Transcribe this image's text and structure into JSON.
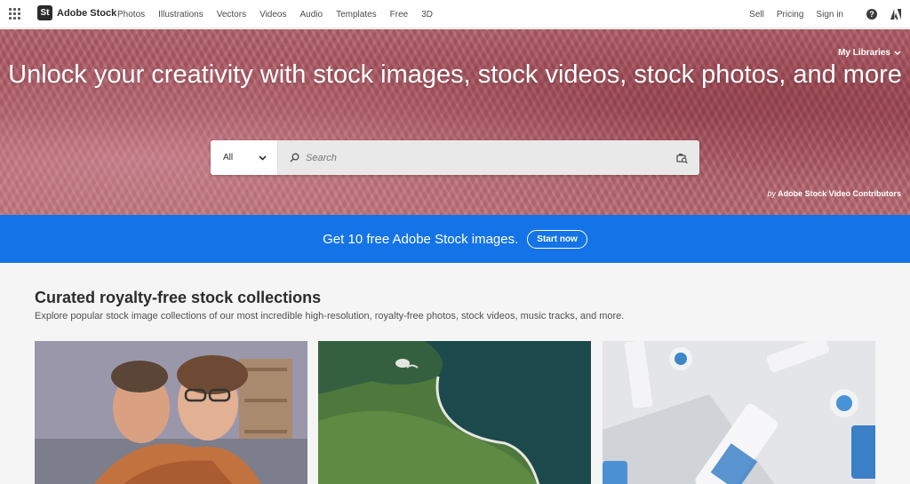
{
  "nav": {
    "brand_logo": "St",
    "brand_name": "Adobe Stock",
    "links": [
      "Photos",
      "Illustrations",
      "Vectors",
      "Videos",
      "Audio",
      "Templates",
      "Free",
      "3D"
    ],
    "right_links": [
      "Sell",
      "Pricing",
      "Sign in"
    ],
    "help_icon": "?",
    "icons": [
      "app-grid-icon",
      "help-icon",
      "adobe-icon"
    ]
  },
  "hero": {
    "title": "Unlock your creativity with stock images, stock videos, stock photos, and more",
    "my_libraries": "My Libraries",
    "search": {
      "category": "All",
      "placeholder": "Search"
    },
    "credit_prefix": "by",
    "credit_name": "Adobe Stock Video Contributors"
  },
  "promo": {
    "text": "Get 10 free Adobe Stock images.",
    "button": "Start now",
    "color": "#1473e6"
  },
  "collections": {
    "title": "Curated royalty-free stock collections",
    "subtitle": "Explore popular stock image collections of our most incredible high-resolution, royalty-free photos, stock videos, music tracks, and more."
  }
}
